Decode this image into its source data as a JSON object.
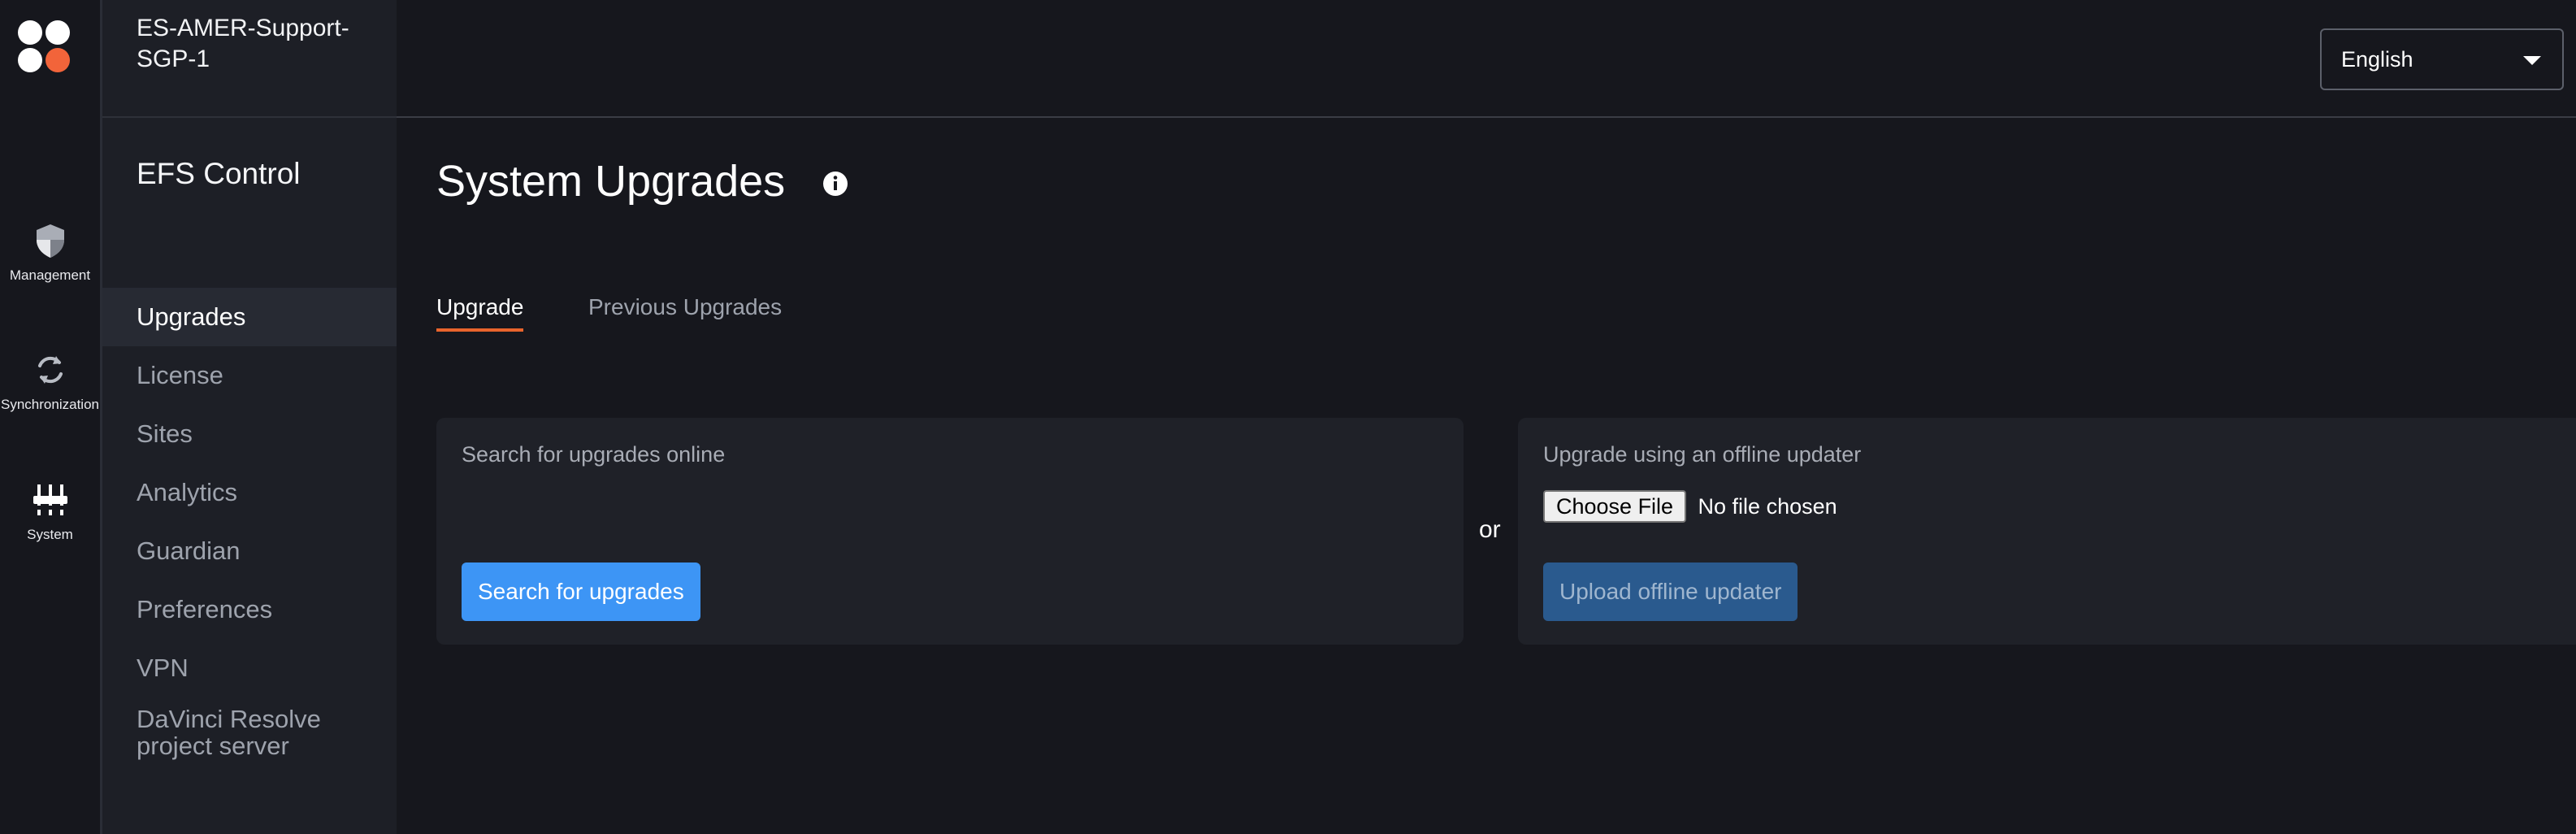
{
  "rail": {
    "items": [
      {
        "label": "Management",
        "icon": "shield-icon"
      },
      {
        "label": "Synchronization",
        "icon": "sync-icon"
      },
      {
        "label": "System",
        "icon": "sliders-icon"
      }
    ]
  },
  "sidebar": {
    "tenant": "ES-AMER-Support-SGP-1",
    "section_title": "EFS Control",
    "items": [
      {
        "label": "Upgrades",
        "active": true
      },
      {
        "label": "License"
      },
      {
        "label": "Sites"
      },
      {
        "label": "Analytics"
      },
      {
        "label": "Guardian"
      },
      {
        "label": "Preferences"
      },
      {
        "label": "VPN"
      },
      {
        "label": "DaVinci Resolve project server"
      }
    ]
  },
  "header": {
    "language": "English"
  },
  "main": {
    "title": "System Upgrades",
    "tabs": [
      {
        "label": "Upgrade",
        "active": true
      },
      {
        "label": "Previous Upgrades"
      }
    ],
    "online": {
      "title": "Search for upgrades online",
      "button": "Search for upgrades"
    },
    "or_label": "or",
    "offline": {
      "title": "Upgrade using an offline updater",
      "choose_file": "Choose File",
      "file_status": "No file chosen",
      "button": "Upload offline updater"
    }
  },
  "colors": {
    "accent_tab": "#e8642c",
    "primary_button": "#3d95f5",
    "background": "#16171d",
    "sidebar": "#1d1f26"
  }
}
